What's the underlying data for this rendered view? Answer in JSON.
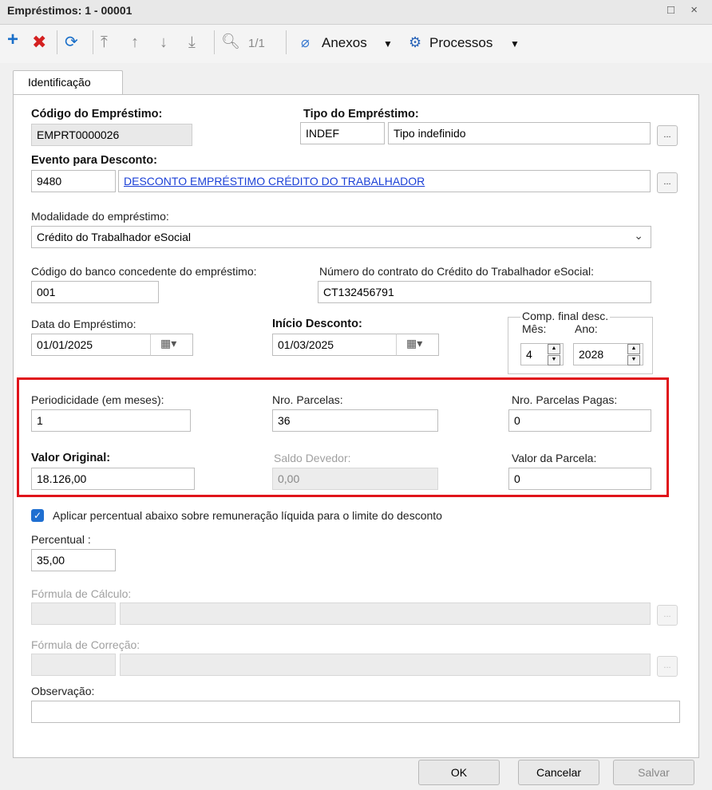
{
  "window": {
    "title": "Empréstimos: 1 - 00001",
    "controls": "□ ×"
  },
  "toolbar": {
    "record_counter": "1/1",
    "attachments_label": "Anexos",
    "processes_label": "Processos"
  },
  "tab": {
    "label": "Identificação"
  },
  "form": {
    "codigo_emprestimo": {
      "label": "Código do Empréstimo:",
      "value": "EMPRT0000026"
    },
    "tipo_emprestimo": {
      "label": "Tipo do Empréstimo:",
      "code": "INDEF",
      "description": "Tipo indefinido"
    },
    "evento_desconto": {
      "label": "Evento para Desconto:",
      "code": "9480",
      "description": "DESCONTO EMPRÉSTIMO CRÉDITO DO TRABALHADOR"
    },
    "modalidade": {
      "label": "Modalidade do empréstimo:",
      "value": "Crédito do Trabalhador eSocial"
    },
    "banco": {
      "label": "Código do banco concedente do empréstimo:",
      "value": "001"
    },
    "contrato": {
      "label": "Número do contrato do Crédito do Trabalhador eSocial:",
      "value": "CT132456791"
    },
    "data_emprestimo": {
      "label": "Data do Empréstimo:",
      "value": "01/01/2025"
    },
    "inicio_desconto": {
      "label": "Início Desconto:",
      "value": "01/03/2025"
    },
    "comp_final": {
      "label": "Comp. final desc.",
      "mes_label": "Mês:",
      "mes": "4",
      "ano_label": "Ano:",
      "ano": "2028"
    },
    "periodicidade": {
      "label": "Periodicidade (em meses):",
      "value": "1"
    },
    "nro_parcelas": {
      "label": "Nro. Parcelas:",
      "value": "36"
    },
    "nro_parcelas_pagas": {
      "label": "Nro. Parcelas Pagas:",
      "value": "0"
    },
    "valor_original": {
      "label": "Valor Original:",
      "value": "18.126,00"
    },
    "saldo_devedor": {
      "label": "Saldo Devedor:",
      "value": "0,00"
    },
    "valor_parcela": {
      "label": "Valor da Parcela:",
      "value": "0"
    },
    "aplicar_percentual": {
      "label": "Aplicar percentual abaixo sobre remuneração líquida para o limite do desconto",
      "checked": true
    },
    "percentual": {
      "label": "Percentual :",
      "value": "35,00"
    },
    "formula_calculo": {
      "label": "Fórmula de Cálculo:"
    },
    "formula_correcao": {
      "label": "Fórmula de Correção:"
    },
    "observacao": {
      "label": "Observação:",
      "value": ""
    }
  },
  "buttons": {
    "ok": "OK",
    "cancel": "Cancelar",
    "save": "Salvar"
  },
  "colors": {
    "highlight": "#e0141b",
    "accent": "#1f6fd1",
    "add": "#1a6fc9",
    "delete": "#d42020",
    "link": "#1a3fd6"
  }
}
